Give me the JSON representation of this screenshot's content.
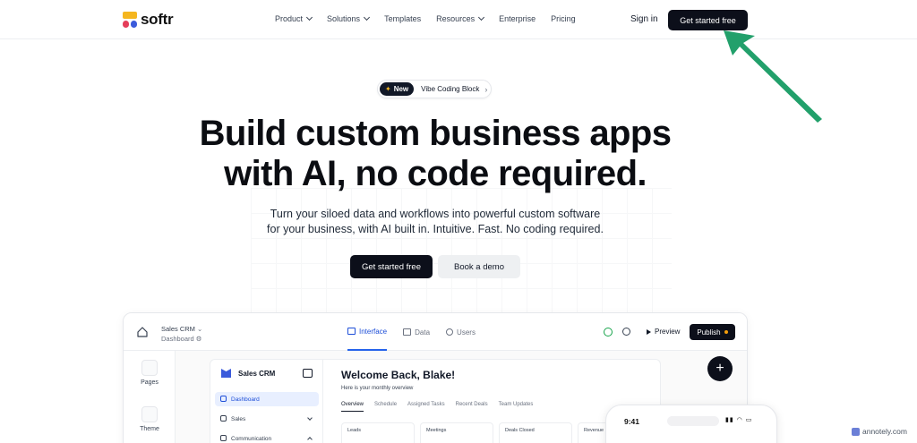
{
  "nav": {
    "logo_text": "softr",
    "links": [
      {
        "label": "Product",
        "has_chevron": true
      },
      {
        "label": "Solutions",
        "has_chevron": true
      },
      {
        "label": "Templates",
        "has_chevron": false
      },
      {
        "label": "Resources",
        "has_chevron": true
      },
      {
        "label": "Enterprise",
        "has_chevron": false
      },
      {
        "label": "Pricing",
        "has_chevron": false
      }
    ],
    "signin": "Sign in",
    "cta": "Get started free"
  },
  "hero": {
    "badge_new": "New",
    "badge_text": "Vibe Coding Block",
    "headline_line1": "Build custom business apps",
    "headline_line2": "with AI, no code required.",
    "sub_line1": "Turn your siloed data and workflows into powerful custom software",
    "sub_line2": "for your business, with AI built in. Intuitive. Fast. No coding required.",
    "primary_btn": "Get started free",
    "secondary_btn": "Book a demo"
  },
  "app": {
    "project_name": "Sales CRM",
    "project_page": "Dashboard",
    "tabs": [
      {
        "label": "Interface",
        "active": true
      },
      {
        "label": "Data",
        "active": false
      },
      {
        "label": "Users",
        "active": false
      }
    ],
    "preview": "Preview",
    "publish": "Publish",
    "rail": [
      {
        "label": "Pages"
      },
      {
        "label": "Theme"
      }
    ],
    "inner_title": "Sales CRM",
    "side_items": [
      {
        "label": "Dashboard",
        "active": true
      },
      {
        "label": "Sales",
        "active": false
      },
      {
        "label": "Communication",
        "active": false
      }
    ],
    "welcome": "Welcome Back, Blake!",
    "overview_sub": "Here is your monthly overview",
    "inner_tabs": [
      {
        "label": "Overview",
        "active": true
      },
      {
        "label": "Schedule",
        "active": false
      },
      {
        "label": "Assigned Tasks",
        "active": false
      },
      {
        "label": "Recent Deals",
        "active": false
      },
      {
        "label": "Team Updates",
        "active": false
      }
    ],
    "cards": [
      {
        "label": "Leads"
      },
      {
        "label": "Meetings"
      },
      {
        "label": "Deals Closed"
      },
      {
        "label": "Revenue"
      }
    ],
    "plus": "+",
    "phone_time": "9:41"
  },
  "watermark": "annotely.com",
  "colors": {
    "annotation_arrow": "#22a06b",
    "brand_dark": "#0c0f1a",
    "active_blue": "#2563eb"
  }
}
